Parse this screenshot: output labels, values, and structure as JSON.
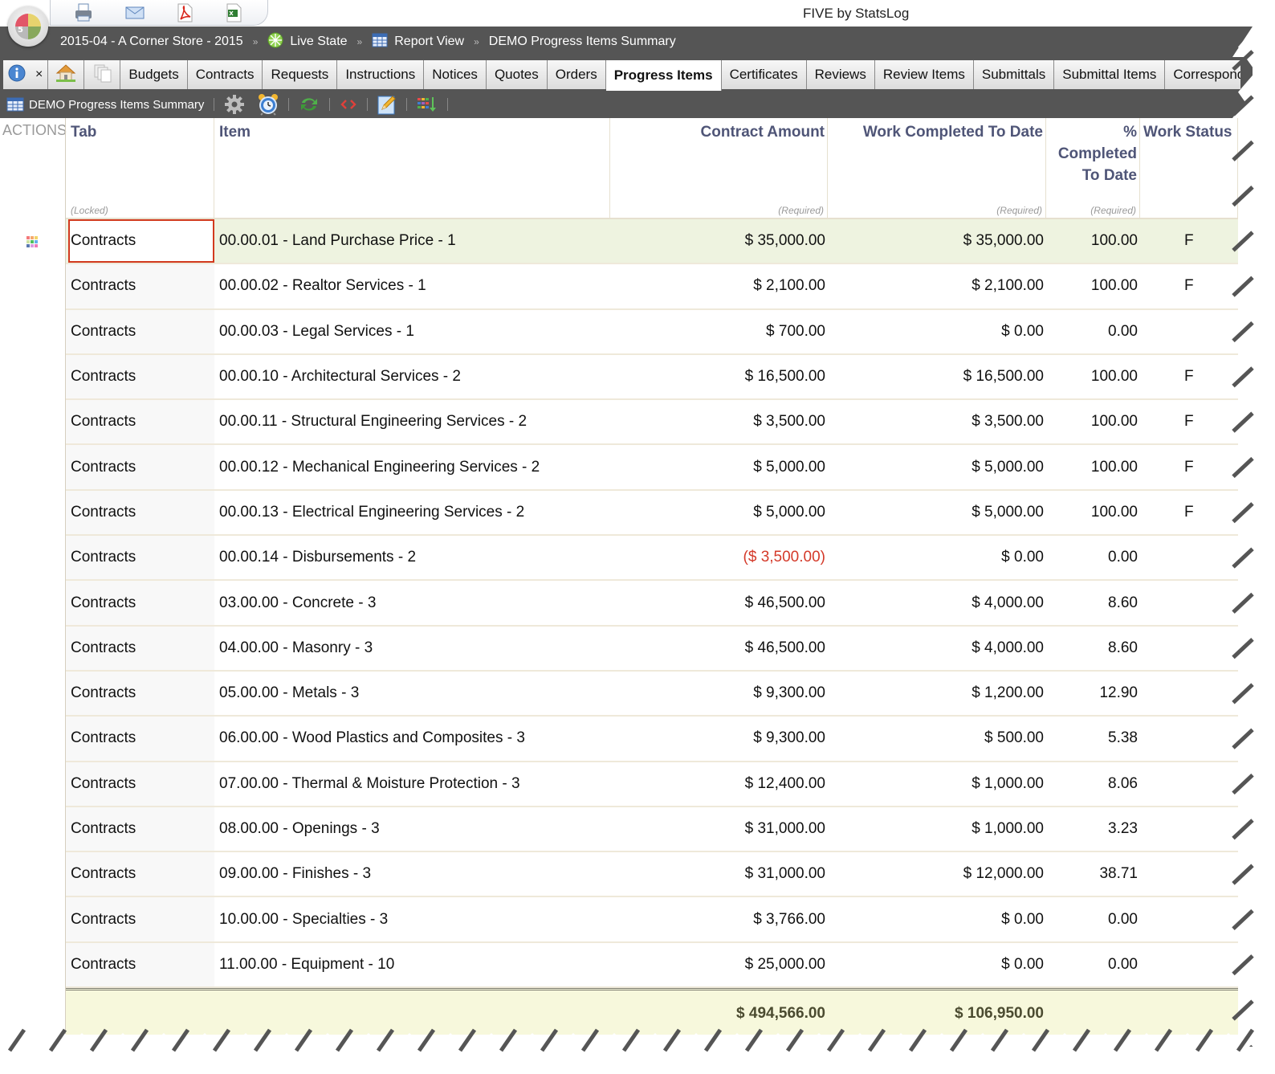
{
  "app": {
    "title": "FIVE by StatsLog",
    "logo_number": "5"
  },
  "quick_actions": [
    {
      "name": "print-icon",
      "label": "Print"
    },
    {
      "name": "email-icon",
      "label": "Email"
    },
    {
      "name": "pdf-icon",
      "label": "PDF"
    },
    {
      "name": "excel-icon",
      "label": "Excel"
    }
  ],
  "breadcrumb": {
    "project": "2015-04 - A Corner Store - 2015",
    "state": "Live State",
    "view": "Report View",
    "report": "DEMO Progress Items Summary",
    "separator": "»"
  },
  "tabs": {
    "close_glyph": "×",
    "items": [
      {
        "label": "Budgets",
        "active": false
      },
      {
        "label": "Contracts",
        "active": false
      },
      {
        "label": "Requests",
        "active": false
      },
      {
        "label": "Instructions",
        "active": false
      },
      {
        "label": "Notices",
        "active": false
      },
      {
        "label": "Quotes",
        "active": false
      },
      {
        "label": "Orders",
        "active": false
      },
      {
        "label": "Progress Items",
        "active": true
      },
      {
        "label": "Certificates",
        "active": false
      },
      {
        "label": "Reviews",
        "active": false
      },
      {
        "label": "Review Items",
        "active": false
      },
      {
        "label": "Submittals",
        "active": false
      },
      {
        "label": "Submittal Items",
        "active": false
      },
      {
        "label": "Correspondence",
        "active": false
      }
    ]
  },
  "toolbar": {
    "report_title": "DEMO Progress Items Summary",
    "buttons": [
      "settings",
      "schedule",
      "refresh",
      "code",
      "edit",
      "column-order"
    ]
  },
  "table": {
    "actions_label": "ACTIONS",
    "columns": [
      {
        "key": "tab",
        "label": "Tab",
        "sub": "(Locked)"
      },
      {
        "key": "item",
        "label": "Item",
        "sub": ""
      },
      {
        "key": "contract_amount",
        "label": "Contract Amount",
        "sub": "(Required)"
      },
      {
        "key": "work_completed",
        "label": "Work Completed To Date",
        "sub": "(Required)"
      },
      {
        "key": "pct_completed",
        "label": "% Completed To Date",
        "sub": "(Required)"
      },
      {
        "key": "work_status",
        "label": "Work Status",
        "sub": ""
      }
    ],
    "selected_row": 0,
    "rows": [
      {
        "tab": "Contracts",
        "item": "00.00.01 - Land Purchase Price - 1",
        "contract_amount": "$ 35,000.00",
        "work_completed": "$ 35,000.00",
        "pct_completed": "100.00",
        "work_status": "F",
        "negative": false
      },
      {
        "tab": "Contracts",
        "item": "00.00.02 - Realtor Services - 1",
        "contract_amount": "$ 2,100.00",
        "work_completed": "$ 2,100.00",
        "pct_completed": "100.00",
        "work_status": "F",
        "negative": false
      },
      {
        "tab": "Contracts",
        "item": "00.00.03 - Legal Services - 1",
        "contract_amount": "$ 700.00",
        "work_completed": "$ 0.00",
        "pct_completed": "0.00",
        "work_status": "",
        "negative": false
      },
      {
        "tab": "Contracts",
        "item": "00.00.10 - Architectural Services - 2",
        "contract_amount": "$ 16,500.00",
        "work_completed": "$ 16,500.00",
        "pct_completed": "100.00",
        "work_status": "F",
        "negative": false
      },
      {
        "tab": "Contracts",
        "item": "00.00.11 - Structural Engineering Services - 2",
        "contract_amount": "$ 3,500.00",
        "work_completed": "$ 3,500.00",
        "pct_completed": "100.00",
        "work_status": "F",
        "negative": false
      },
      {
        "tab": "Contracts",
        "item": "00.00.12 - Mechanical Engineering Services - 2",
        "contract_amount": "$ 5,000.00",
        "work_completed": "$ 5,000.00",
        "pct_completed": "100.00",
        "work_status": "F",
        "negative": false
      },
      {
        "tab": "Contracts",
        "item": "00.00.13 - Electrical Engineering Services - 2",
        "contract_amount": "$ 5,000.00",
        "work_completed": "$ 5,000.00",
        "pct_completed": "100.00",
        "work_status": "F",
        "negative": false
      },
      {
        "tab": "Contracts",
        "item": "00.00.14 - Disbursements - 2",
        "contract_amount": "($ 3,500.00)",
        "work_completed": "$ 0.00",
        "pct_completed": "0.00",
        "work_status": "",
        "negative": true
      },
      {
        "tab": "Contracts",
        "item": "03.00.00 - Concrete - 3",
        "contract_amount": "$ 46,500.00",
        "work_completed": "$ 4,000.00",
        "pct_completed": "8.60",
        "work_status": "",
        "negative": false
      },
      {
        "tab": "Contracts",
        "item": "04.00.00 - Masonry - 3",
        "contract_amount": "$ 46,500.00",
        "work_completed": "$ 4,000.00",
        "pct_completed": "8.60",
        "work_status": "",
        "negative": false
      },
      {
        "tab": "Contracts",
        "item": "05.00.00 - Metals - 3",
        "contract_amount": "$ 9,300.00",
        "work_completed": "$ 1,200.00",
        "pct_completed": "12.90",
        "work_status": "",
        "negative": false
      },
      {
        "tab": "Contracts",
        "item": "06.00.00 - Wood Plastics and Composites - 3",
        "contract_amount": "$ 9,300.00",
        "work_completed": "$ 500.00",
        "pct_completed": "5.38",
        "work_status": "",
        "negative": false
      },
      {
        "tab": "Contracts",
        "item": "07.00.00 - Thermal & Moisture Protection - 3",
        "contract_amount": "$ 12,400.00",
        "work_completed": "$ 1,000.00",
        "pct_completed": "8.06",
        "work_status": "",
        "negative": false
      },
      {
        "tab": "Contracts",
        "item": "08.00.00 - Openings - 3",
        "contract_amount": "$ 31,000.00",
        "work_completed": "$ 1,000.00",
        "pct_completed": "3.23",
        "work_status": "",
        "negative": false
      },
      {
        "tab": "Contracts",
        "item": "09.00.00 - Finishes - 3",
        "contract_amount": "$ 31,000.00",
        "work_completed": "$ 12,000.00",
        "pct_completed": "38.71",
        "work_status": "",
        "negative": false
      },
      {
        "tab": "Contracts",
        "item": "10.00.00 - Specialties - 3",
        "contract_amount": "$ 3,766.00",
        "work_completed": "$ 0.00",
        "pct_completed": "0.00",
        "work_status": "",
        "negative": false
      },
      {
        "tab": "Contracts",
        "item": "11.00.00 - Equipment - 10",
        "contract_amount": "$ 25,000.00",
        "work_completed": "$ 0.00",
        "pct_completed": "0.00",
        "work_status": "",
        "negative": false
      }
    ],
    "totals": {
      "contract_amount": "$ 494,566.00",
      "work_completed": "$ 106,950.00"
    }
  },
  "colors": {
    "bar_dark": "#555555",
    "header_text": "#4f5577",
    "selected_row": "#eef3e0",
    "selection_border": "#d23a1e",
    "negative": "#d43a2a",
    "totals_bg": "#f7f8dc"
  }
}
